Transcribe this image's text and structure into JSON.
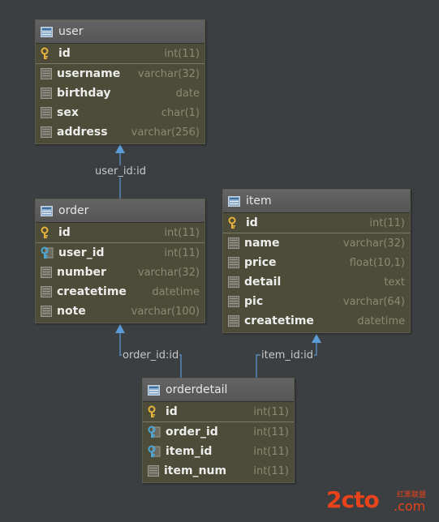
{
  "tables": {
    "user": {
      "title": "user",
      "pk": {
        "name": "id",
        "type": "int(11)"
      },
      "fields": [
        {
          "name": "username",
          "type": "varchar(32)",
          "icon": "column-icon"
        },
        {
          "name": "birthday",
          "type": "date",
          "icon": "column-icon"
        },
        {
          "name": "sex",
          "type": "char(1)",
          "icon": "column-icon"
        },
        {
          "name": "address",
          "type": "varchar(256)",
          "icon": "column-icon"
        }
      ]
    },
    "order": {
      "title": "order",
      "pk": {
        "name": "id",
        "type": "int(11)"
      },
      "fields": [
        {
          "name": "user_id",
          "type": "int(11)",
          "icon": "foreign-key-icon"
        },
        {
          "name": "number",
          "type": "varchar(32)",
          "icon": "column-icon"
        },
        {
          "name": "createtime",
          "type": "datetime",
          "icon": "column-icon"
        },
        {
          "name": "note",
          "type": "varchar(100)",
          "icon": "column-icon"
        }
      ]
    },
    "item": {
      "title": "item",
      "pk": {
        "name": "id",
        "type": "int(11)"
      },
      "fields": [
        {
          "name": "name",
          "type": "varchar(32)",
          "icon": "column-icon"
        },
        {
          "name": "price",
          "type": "float(10,1)",
          "icon": "column-icon"
        },
        {
          "name": "detail",
          "type": "text",
          "icon": "column-icon"
        },
        {
          "name": "pic",
          "type": "varchar(64)",
          "icon": "column-icon"
        },
        {
          "name": "createtime",
          "type": "datetime",
          "icon": "column-icon"
        }
      ]
    },
    "orderdetail": {
      "title": "orderdetail",
      "pk": {
        "name": "id",
        "type": "int(11)"
      },
      "fields": [
        {
          "name": "order_id",
          "type": "int(11)",
          "icon": "foreign-key-icon"
        },
        {
          "name": "item_id",
          "type": "int(11)",
          "icon": "foreign-key-icon"
        },
        {
          "name": "item_num",
          "type": "int(11)",
          "icon": "column-icon"
        }
      ]
    }
  },
  "relations": {
    "order_user": "user_id:id",
    "orderdetail_order": "order_id:id",
    "orderdetail_item": "item_id:id"
  },
  "watermark": {
    "brand": "2cto",
    "sub": "红黑联盟",
    "domain": ".com"
  },
  "colors": {
    "background": "#3c3f41",
    "table_body": "#4c4c38",
    "relation_line": "#5b9bd5",
    "key_icon": "#e8b33c",
    "watermark": "#e8431b"
  }
}
